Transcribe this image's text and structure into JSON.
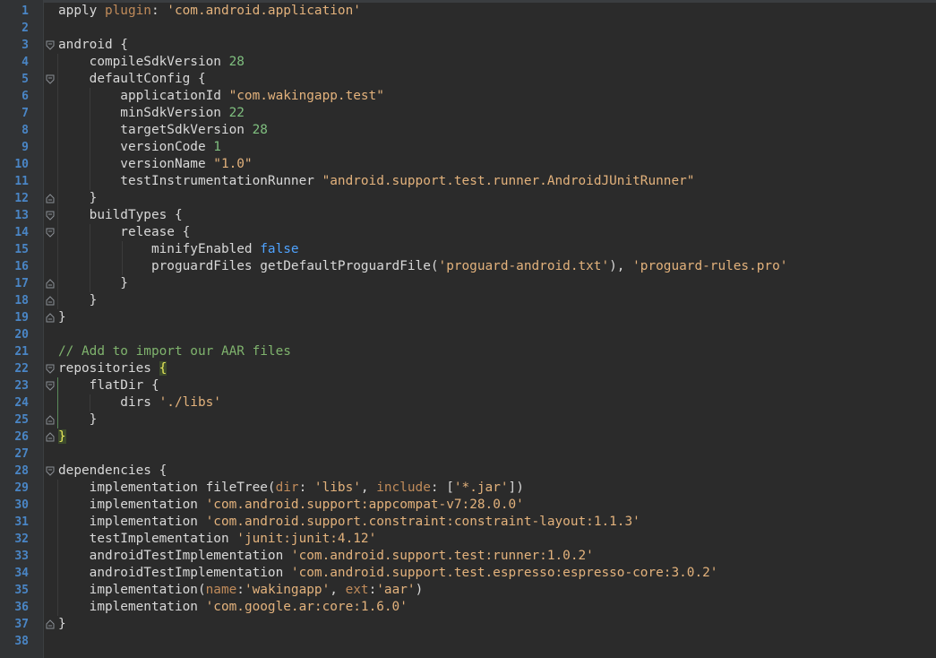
{
  "editor": {
    "language": "groovy",
    "colors": {
      "background": "#2b2b2b",
      "line_number": "#4a86c6",
      "number": "#7fbf7f",
      "string": "#e3b27c",
      "comment": "#7fb36d",
      "keyword_false": "#4fa3ff"
    }
  },
  "lines": [
    {
      "n": "1",
      "t": [
        {
          "s": "apply ",
          "c": ""
        },
        {
          "s": "plugin",
          "c": "param"
        },
        {
          "s": ": ",
          "c": ""
        },
        {
          "s": "'com.android.application'",
          "c": "str"
        }
      ]
    },
    {
      "n": "2",
      "t": []
    },
    {
      "n": "3",
      "fold": "open",
      "t": [
        {
          "s": "android {",
          "c": ""
        }
      ]
    },
    {
      "n": "4",
      "t": [
        {
          "s": "    compileSdkVersion ",
          "c": ""
        },
        {
          "s": "28",
          "c": "num"
        }
      ]
    },
    {
      "n": "5",
      "fold": "open",
      "t": [
        {
          "s": "    defaultConfig {",
          "c": ""
        }
      ]
    },
    {
      "n": "6",
      "t": [
        {
          "s": "        applicationId ",
          "c": ""
        },
        {
          "s": "\"com.wakingapp.test\"",
          "c": "str"
        }
      ]
    },
    {
      "n": "7",
      "t": [
        {
          "s": "        minSdkVersion ",
          "c": ""
        },
        {
          "s": "22",
          "c": "num"
        }
      ]
    },
    {
      "n": "8",
      "t": [
        {
          "s": "        targetSdkVersion ",
          "c": ""
        },
        {
          "s": "28",
          "c": "num"
        }
      ]
    },
    {
      "n": "9",
      "t": [
        {
          "s": "        versionCode ",
          "c": ""
        },
        {
          "s": "1",
          "c": "num"
        }
      ]
    },
    {
      "n": "10",
      "t": [
        {
          "s": "        versionName ",
          "c": ""
        },
        {
          "s": "\"1.0\"",
          "c": "str"
        }
      ]
    },
    {
      "n": "11",
      "t": [
        {
          "s": "        testInstrumentationRunner ",
          "c": ""
        },
        {
          "s": "\"android.support.test.runner.AndroidJUnitRunner\"",
          "c": "str"
        }
      ]
    },
    {
      "n": "12",
      "fold": "close",
      "t": [
        {
          "s": "    }",
          "c": ""
        }
      ]
    },
    {
      "n": "13",
      "fold": "open",
      "t": [
        {
          "s": "    buildTypes {",
          "c": ""
        }
      ]
    },
    {
      "n": "14",
      "fold": "open",
      "t": [
        {
          "s": "        release {",
          "c": ""
        }
      ]
    },
    {
      "n": "15",
      "t": [
        {
          "s": "            minifyEnabled ",
          "c": ""
        },
        {
          "s": "false",
          "c": "blue"
        }
      ]
    },
    {
      "n": "16",
      "t": [
        {
          "s": "            proguardFiles getDefaultProguardFile(",
          "c": ""
        },
        {
          "s": "'proguard-android.txt'",
          "c": "str"
        },
        {
          "s": "), ",
          "c": ""
        },
        {
          "s": "'proguard-rules.pro'",
          "c": "str"
        }
      ]
    },
    {
      "n": "17",
      "fold": "close",
      "t": [
        {
          "s": "        }",
          "c": ""
        }
      ]
    },
    {
      "n": "18",
      "fold": "close",
      "t": [
        {
          "s": "    }",
          "c": ""
        }
      ]
    },
    {
      "n": "19",
      "fold": "close",
      "t": [
        {
          "s": "}",
          "c": ""
        }
      ]
    },
    {
      "n": "20",
      "t": []
    },
    {
      "n": "21",
      "t": [
        {
          "s": "// Add to import our AAR files",
          "c": "cmt"
        }
      ]
    },
    {
      "n": "22",
      "fold": "open",
      "t": [
        {
          "s": "repositories ",
          "c": ""
        },
        {
          "s": "{",
          "c": "hl"
        }
      ]
    },
    {
      "n": "23",
      "fold": "open",
      "t": [
        {
          "s": "    flatDir {",
          "c": ""
        }
      ]
    },
    {
      "n": "24",
      "t": [
        {
          "s": "        dirs ",
          "c": ""
        },
        {
          "s": "'./libs'",
          "c": "str"
        }
      ]
    },
    {
      "n": "25",
      "fold": "close",
      "t": [
        {
          "s": "    }",
          "c": ""
        }
      ]
    },
    {
      "n": "26",
      "fold": "close",
      "t": [
        {
          "s": "}",
          "c": "hl"
        }
      ]
    },
    {
      "n": "27",
      "t": []
    },
    {
      "n": "28",
      "fold": "open",
      "t": [
        {
          "s": "dependencies {",
          "c": ""
        }
      ]
    },
    {
      "n": "29",
      "t": [
        {
          "s": "    implementation fileTree(",
          "c": ""
        },
        {
          "s": "dir",
          "c": "param"
        },
        {
          "s": ": ",
          "c": ""
        },
        {
          "s": "'libs'",
          "c": "str"
        },
        {
          "s": ", ",
          "c": ""
        },
        {
          "s": "include",
          "c": "param"
        },
        {
          "s": ": [",
          "c": ""
        },
        {
          "s": "'*.jar'",
          "c": "str"
        },
        {
          "s": "])",
          "c": ""
        }
      ]
    },
    {
      "n": "30",
      "t": [
        {
          "s": "    implementation ",
          "c": ""
        },
        {
          "s": "'com.android.support:appcompat-v7:28.0.0'",
          "c": "str"
        }
      ]
    },
    {
      "n": "31",
      "t": [
        {
          "s": "    implementation ",
          "c": ""
        },
        {
          "s": "'com.android.support.constraint:constraint-layout:1.1.3'",
          "c": "str"
        }
      ]
    },
    {
      "n": "32",
      "t": [
        {
          "s": "    testImplementation ",
          "c": ""
        },
        {
          "s": "'junit:junit:4.12'",
          "c": "str"
        }
      ]
    },
    {
      "n": "33",
      "t": [
        {
          "s": "    androidTestImplementation ",
          "c": ""
        },
        {
          "s": "'com.android.support.test:runner:1.0.2'",
          "c": "str"
        }
      ]
    },
    {
      "n": "34",
      "t": [
        {
          "s": "    androidTestImplementation ",
          "c": ""
        },
        {
          "s": "'com.android.support.test.espresso:espresso-core:3.0.2'",
          "c": "str"
        }
      ]
    },
    {
      "n": "35",
      "t": [
        {
          "s": "    implementation(",
          "c": ""
        },
        {
          "s": "name",
          "c": "param"
        },
        {
          "s": ":",
          "c": ""
        },
        {
          "s": "'wakingapp'",
          "c": "str"
        },
        {
          "s": ", ",
          "c": ""
        },
        {
          "s": "ext",
          "c": "param"
        },
        {
          "s": ":",
          "c": ""
        },
        {
          "s": "'aar'",
          "c": "str"
        },
        {
          "s": ")",
          "c": ""
        }
      ]
    },
    {
      "n": "36",
      "t": [
        {
          "s": "    implementation ",
          "c": ""
        },
        {
          "s": "'com.google.ar:core:1.6.0'",
          "c": "str"
        }
      ]
    },
    {
      "n": "37",
      "fold": "close",
      "t": [
        {
          "s": "}",
          "c": ""
        }
      ]
    },
    {
      "n": "38",
      "t": []
    }
  ]
}
